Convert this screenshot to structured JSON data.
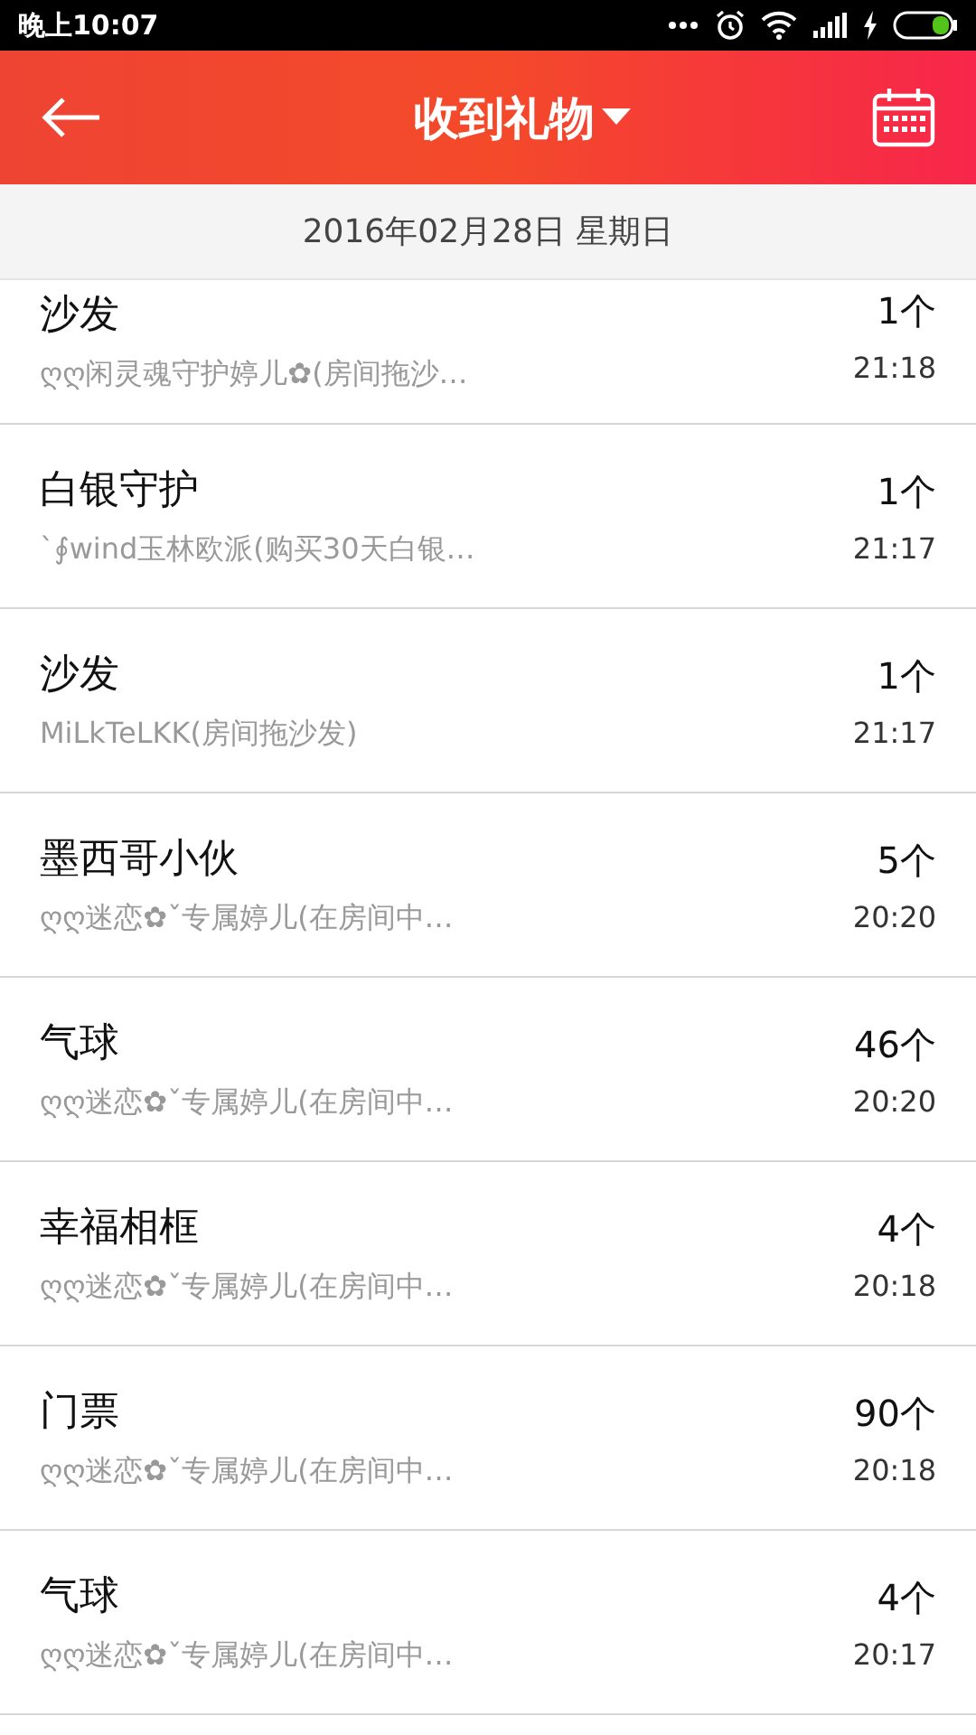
{
  "status_bar": {
    "time": "晚上10:07"
  },
  "header": {
    "title": "收到礼物"
  },
  "date_header": "2016年02月28日 星期日",
  "gifts": [
    {
      "name": "沙发",
      "sender": "ღღ闲灵魂守护婷儿✿(房间拖沙…",
      "count": "1个",
      "time": "21:18"
    },
    {
      "name": "白银守护",
      "sender": "ˋ∮wind玉林欧派(购买30天白银…",
      "count": "1个",
      "time": "21:17"
    },
    {
      "name": "沙发",
      "sender": "MiLkTeLKK(房间拖沙发)",
      "count": "1个",
      "time": "21:17"
    },
    {
      "name": "墨西哥小伙",
      "sender": "ღღ迷恋✿ˇ专属婷儿(在房间中…",
      "count": "5个",
      "time": "20:20"
    },
    {
      "name": "气球",
      "sender": "ღღ迷恋✿ˇ专属婷儿(在房间中…",
      "count": "46个",
      "time": "20:20"
    },
    {
      "name": "幸福相框",
      "sender": "ღღ迷恋✿ˇ专属婷儿(在房间中…",
      "count": "4个",
      "time": "20:18"
    },
    {
      "name": "门票",
      "sender": "ღღ迷恋✿ˇ专属婷儿(在房间中…",
      "count": "90个",
      "time": "20:18"
    },
    {
      "name": "气球",
      "sender": "ღღ迷恋✿ˇ专属婷儿(在房间中…",
      "count": "4个",
      "time": "20:17"
    }
  ]
}
